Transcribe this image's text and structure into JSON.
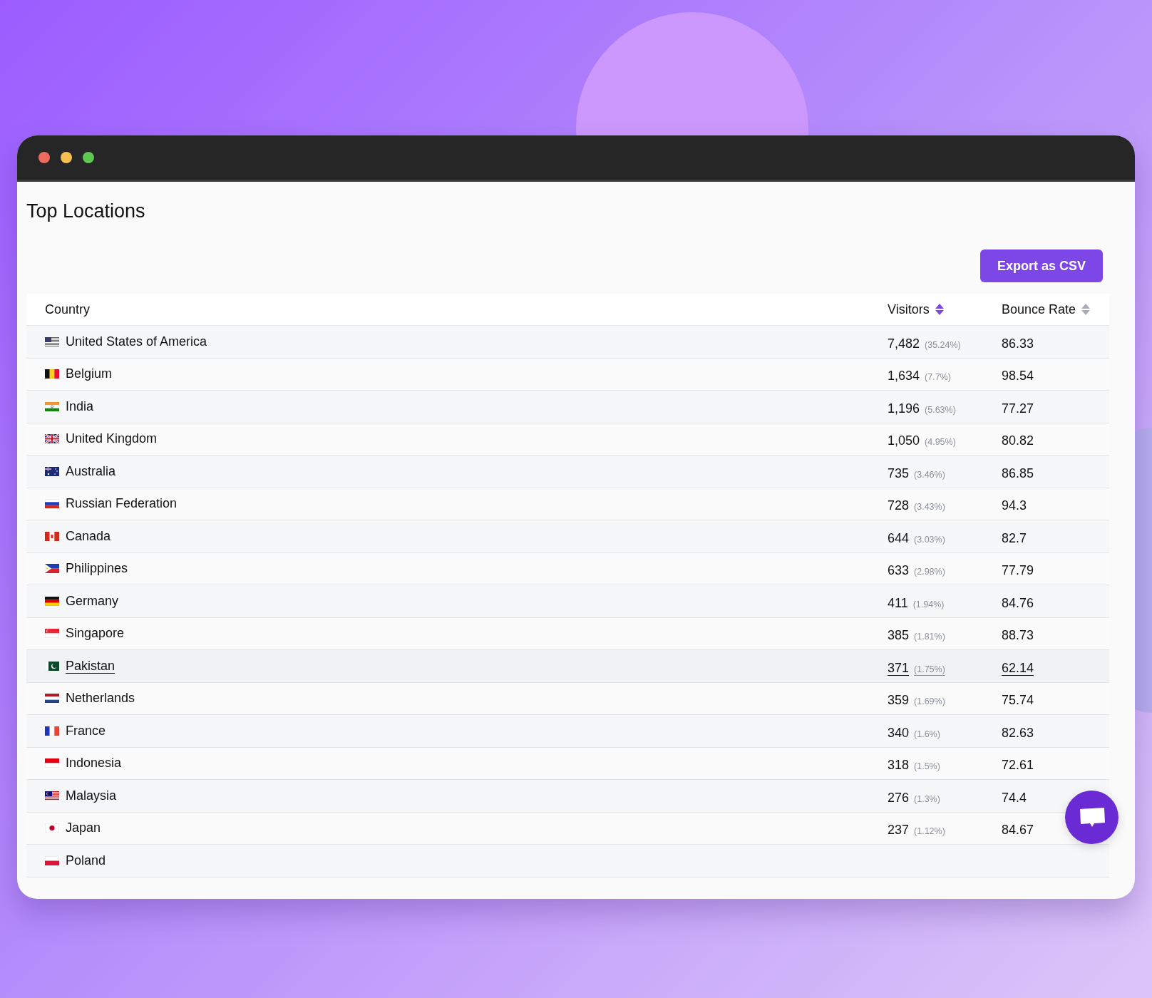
{
  "window": {
    "title": "Top Locations"
  },
  "export_button": {
    "label": "Export as CSV"
  },
  "table": {
    "columns": [
      {
        "label": "Country"
      },
      {
        "label": "Visitors",
        "sorted": true
      },
      {
        "label": "Bounce Rate",
        "sorted": false
      }
    ],
    "rows": [
      {
        "kind": "us",
        "country": "United States of America",
        "visitors": "7,482",
        "share": "(35.24%)",
        "bounce_rate": "86.33",
        "hovered": false
      },
      {
        "kind": "be",
        "country": "Belgium",
        "visitors": "1,634",
        "share": "(7.7%)",
        "bounce_rate": "98.54",
        "hovered": false
      },
      {
        "kind": "in",
        "country": "India",
        "visitors": "1,196",
        "share": "(5.63%)",
        "bounce_rate": "77.27",
        "hovered": false
      },
      {
        "kind": "gb",
        "country": "United Kingdom",
        "visitors": "1,050",
        "share": "(4.95%)",
        "bounce_rate": "80.82",
        "hovered": false
      },
      {
        "kind": "au",
        "country": "Australia",
        "visitors": "735",
        "share": "(3.46%)",
        "bounce_rate": "86.85",
        "hovered": false
      },
      {
        "kind": "ru",
        "country": "Russian Federation",
        "visitors": "728",
        "share": "(3.43%)",
        "bounce_rate": "94.3",
        "hovered": false
      },
      {
        "kind": "ca",
        "country": "Canada",
        "visitors": "644",
        "share": "(3.03%)",
        "bounce_rate": "82.7",
        "hovered": false
      },
      {
        "kind": "ph",
        "country": "Philippines",
        "visitors": "633",
        "share": "(2.98%)",
        "bounce_rate": "77.79",
        "hovered": false
      },
      {
        "kind": "de",
        "country": "Germany",
        "visitors": "411",
        "share": "(1.94%)",
        "bounce_rate": "84.76",
        "hovered": false
      },
      {
        "kind": "sg",
        "country": "Singapore",
        "visitors": "385",
        "share": "(1.81%)",
        "bounce_rate": "88.73",
        "hovered": false
      },
      {
        "kind": "pk",
        "country": "Pakistan",
        "visitors": "371",
        "share": "(1.75%)",
        "bounce_rate": "62.14",
        "hovered": true
      },
      {
        "kind": "nl",
        "country": "Netherlands",
        "visitors": "359",
        "share": "(1.69%)",
        "bounce_rate": "75.74",
        "hovered": false
      },
      {
        "kind": "fr",
        "country": "France",
        "visitors": "340",
        "share": "(1.6%)",
        "bounce_rate": "82.63",
        "hovered": false
      },
      {
        "kind": "id",
        "country": "Indonesia",
        "visitors": "318",
        "share": "(1.5%)",
        "bounce_rate": "72.61",
        "hovered": false
      },
      {
        "kind": "my",
        "country": "Malaysia",
        "visitors": "276",
        "share": "(1.3%)",
        "bounce_rate": "74.4",
        "hovered": false
      },
      {
        "kind": "jp",
        "country": "Japan",
        "visitors": "237",
        "share": "(1.12%)",
        "bounce_rate": "84.67",
        "hovered": false
      },
      {
        "kind": "pl",
        "country": "Poland",
        "hovered": false
      }
    ]
  }
}
